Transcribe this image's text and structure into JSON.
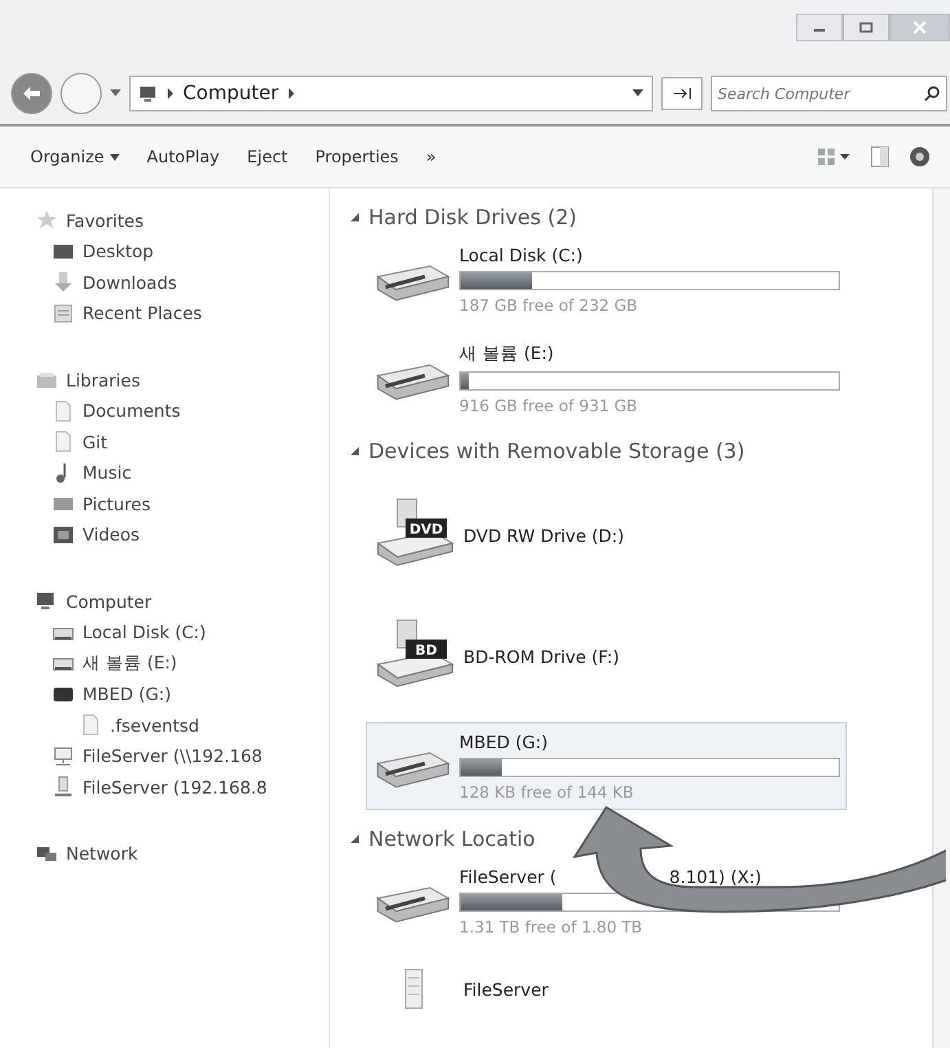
{
  "address_bar": {
    "crumbs": [
      "Computer"
    ],
    "search": {
      "placeholder": "Search Computer"
    }
  },
  "toolbar": {
    "buttons": [
      {
        "label": "Organize",
        "dropdown": true
      },
      {
        "label": "AutoPlay",
        "dropdown": false
      },
      {
        "label": "Eject",
        "dropdown": false
      },
      {
        "label": "Properties",
        "dropdown": false
      },
      {
        "label": "»",
        "dropdown": false
      }
    ]
  },
  "sidebar": {
    "groups": [
      {
        "label": "Favorites",
        "items": [
          {
            "label": "Desktop"
          },
          {
            "label": "Downloads"
          },
          {
            "label": "Recent Places"
          }
        ]
      },
      {
        "label": "Libraries",
        "items": [
          {
            "label": "Documents"
          },
          {
            "label": "Git"
          },
          {
            "label": "Music"
          },
          {
            "label": "Pictures"
          },
          {
            "label": "Videos"
          }
        ]
      },
      {
        "label": "Computer",
        "items": [
          {
            "label": "Local Disk (C:)"
          },
          {
            "label": "새 볼륨 (E:)"
          },
          {
            "label": "MBED (G:)",
            "children": [
              {
                "label": ".fseventsd"
              }
            ]
          },
          {
            "label": "FileServer (\\\\192.168"
          },
          {
            "label": "FileServer (192.168.8"
          }
        ]
      },
      {
        "label": "Network"
      }
    ]
  },
  "sections": [
    {
      "title": "Hard Disk Drives (2)",
      "expanded": true,
      "items": [
        {
          "kind": "drive",
          "name": "Local Disk (C:)",
          "level": 0.19,
          "free": "187 GB free of 232 GB",
          "selected": false
        },
        {
          "kind": "drive",
          "name": "새 볼륨 (E:)",
          "level": 0.02,
          "free": "916 GB free of 931 GB",
          "selected": false
        }
      ]
    },
    {
      "title": "Devices with Removable Storage (3)",
      "expanded": true,
      "items": [
        {
          "kind": "optical",
          "name": "DVD RW Drive (D:)",
          "badge": "DVD",
          "selected": false
        },
        {
          "kind": "optical",
          "name": "BD-ROM Drive (F:)",
          "badge": "BD",
          "selected": false
        },
        {
          "kind": "drive",
          "name": "MBED (G:)",
          "level": 0.11,
          "free": "128 KB free of 144 KB",
          "selected": true
        }
      ]
    },
    {
      "title": "Network Locatio",
      "expanded": true,
      "items": [
        {
          "kind": "drive",
          "name": "FileServer (",
          "name_end": "8.101) (X:)",
          "level": 0.27,
          "free": "1.31 TB free of 1.80 TB",
          "selected": false
        },
        {
          "kind": "folder",
          "name": "FileServer",
          "selected": false
        }
      ]
    }
  ]
}
